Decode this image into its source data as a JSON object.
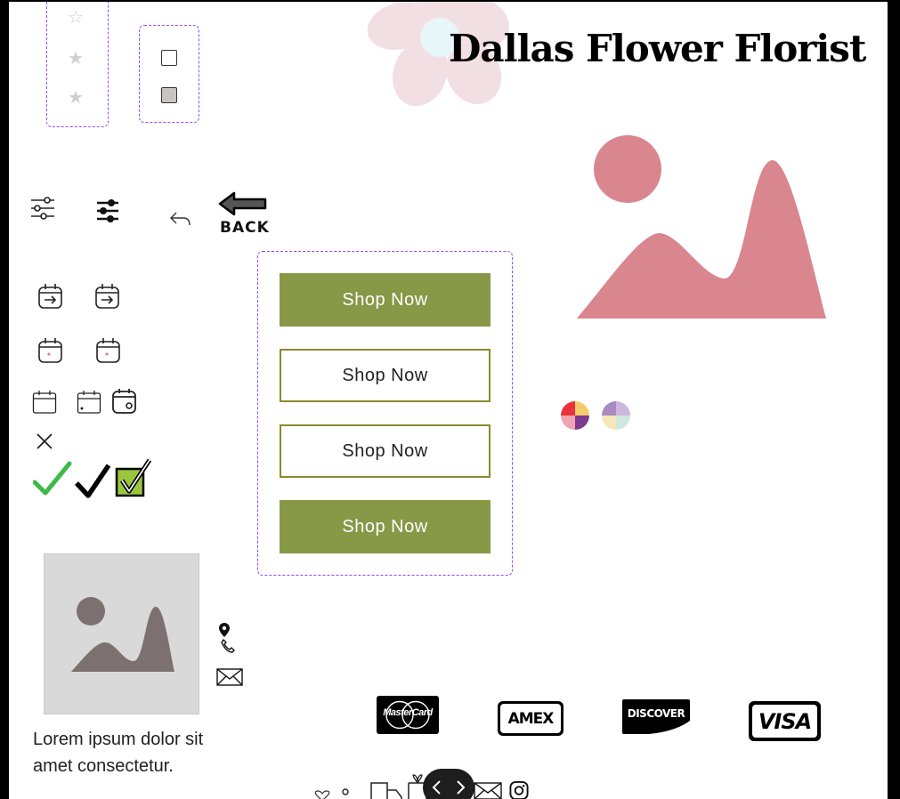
{
  "brand": {
    "title": "Dallas Flower Florist"
  },
  "buttons": {
    "shop_1": "Shop Now",
    "shop_2": "Shop Now",
    "shop_3": "Shop Now",
    "shop_4": "Shop Now"
  },
  "back": {
    "label": "BACK"
  },
  "text": {
    "lorem": "Lorem ipsum dolor sit amet consectetur."
  },
  "payments": {
    "mastercard": "MasterCard",
    "amex": "AMEX",
    "discover": "DISCOVER",
    "visa": "VISA"
  },
  "colors": {
    "accent_green": "#879846",
    "outline_olive": "#8a8a2e",
    "rose": "#d9868f",
    "dashed_purple": "#9747ff",
    "placeholder_gray": "#d9d9d9",
    "placeholder_shape": "#7d7070"
  },
  "icons": [
    "star-outline-icon",
    "star-icon",
    "checkbox-empty-icon",
    "checkbox-filled-icon",
    "filter-sliders-icon",
    "undo-arrow-icon",
    "back-arrow-icon",
    "calendar-arrow-icon",
    "calendar-dot-icon",
    "calendar-icon",
    "calendar-clock-icon",
    "close-icon",
    "checkmark-icon",
    "checkbox-checked-icon",
    "image-placeholder-icon",
    "location-pin-icon",
    "phone-icon",
    "mail-icon",
    "instagram-icon",
    "chevron-left-icon",
    "chevron-right-icon",
    "color-swatch-icon"
  ]
}
